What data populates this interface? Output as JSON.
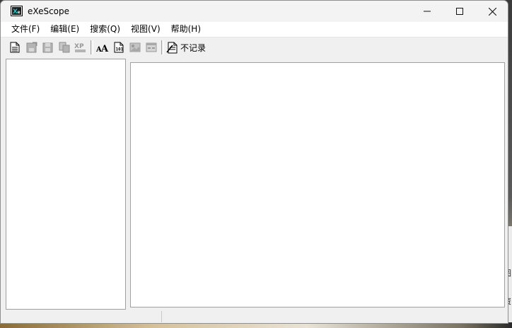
{
  "window": {
    "title": "eXeScope",
    "controls": {
      "minimize": "minimize-icon",
      "maximize": "maximize-icon",
      "close": "close-icon"
    }
  },
  "menu": [
    {
      "label": "文件(F)"
    },
    {
      "label": "编辑(E)"
    },
    {
      "label": "搜索(Q)"
    },
    {
      "label": "视图(V)"
    },
    {
      "label": "帮助(H)"
    }
  ],
  "toolbar": {
    "buttons": [
      {
        "icon": "open-file-icon"
      },
      {
        "icon": "save-icon"
      },
      {
        "icon": "save-as-icon"
      },
      {
        "icon": "copy-icon"
      },
      {
        "icon": "xp-icon"
      },
      {
        "icon": "font-aa-icon"
      },
      {
        "icon": "binary-view-icon"
      },
      {
        "icon": "image-view-icon"
      },
      {
        "icon": "dialog-view-icon"
      },
      {
        "icon": "no-log-icon"
      }
    ],
    "no_log_label": "不记录"
  },
  "desktop": {
    "right_chars": [
      "图",
      "资"
    ]
  },
  "colors": {
    "window_bg": "#f0f0f0",
    "pane_bg": "#ffffff",
    "border": "#a0a0a0"
  }
}
